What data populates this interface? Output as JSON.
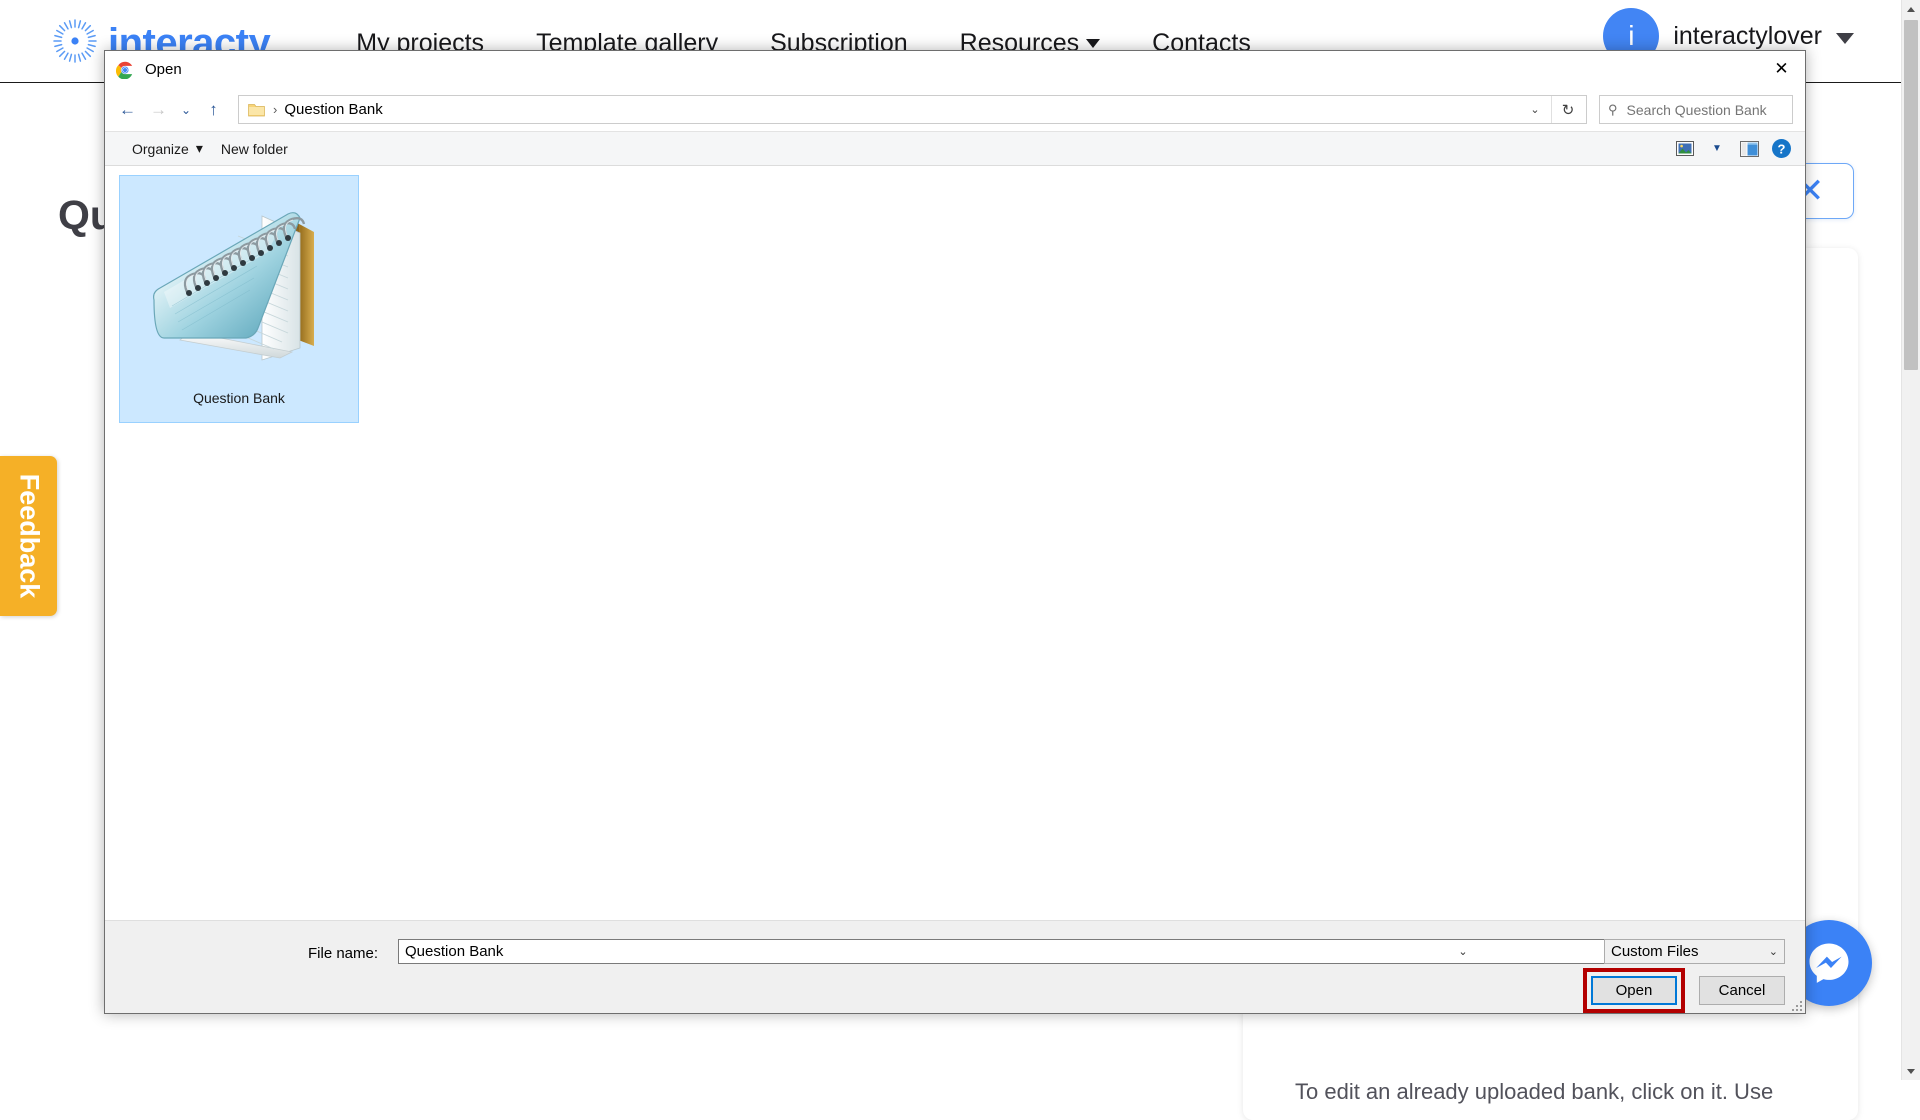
{
  "site": {
    "logo_text": "interacty",
    "logo_icon": "radial-burst-icon",
    "nav": [
      {
        "label": "My projects",
        "has_caret": false
      },
      {
        "label": "Template gallery",
        "has_caret": false
      },
      {
        "label": "Subscription",
        "has_caret": false
      },
      {
        "label": "Resources",
        "has_caret": true
      },
      {
        "label": "Contacts",
        "has_caret": false
      }
    ],
    "user": {
      "avatar_initial": "i",
      "name": "interactylover",
      "avatar_color": "#4285f4"
    },
    "page_title": "Question Bank",
    "close_label": "✕",
    "feedback_label": "Feedback",
    "feedback_color": "#f5b027",
    "hint_text": "To edit an already uploaded bank, click on it. Use",
    "messenger_icon": "messenger-icon",
    "messenger_color": "#3b82f6"
  },
  "dialog": {
    "title": "Open",
    "title_icon": "chrome-icon",
    "close_glyph": "✕",
    "nav": {
      "back_glyph": "←",
      "forward_glyph": "→",
      "recent_glyph": "⌄",
      "up_glyph": "↑"
    },
    "breadcrumb": {
      "folder_icon": "folder-icon",
      "separator": "›",
      "path": "Question Bank",
      "dropdown_glyph": "⌄",
      "refresh_glyph": "↻"
    },
    "search": {
      "icon": "search-icon",
      "placeholder": "Search Question Bank",
      "value": ""
    },
    "toolbar": {
      "organize_label": "Organize",
      "organize_caret": "▾",
      "new_folder_label": "New folder",
      "view_icon": "view-options-icon",
      "view_caret": "▾",
      "preview_pane_icon": "preview-pane-icon",
      "help_icon": "help-icon"
    },
    "files": [
      {
        "name": "Question Bank",
        "icon": "notepad-file-icon",
        "selected": true
      }
    ],
    "footer": {
      "file_name_label": "File name:",
      "file_name_value": "Question Bank",
      "file_name_caret": "⌄",
      "file_type_value": "Custom Files",
      "file_type_caret": "⌄",
      "open_label": "Open",
      "cancel_label": "Cancel",
      "highlight_color": "#b30000",
      "focus_color": "#0078d7"
    }
  }
}
